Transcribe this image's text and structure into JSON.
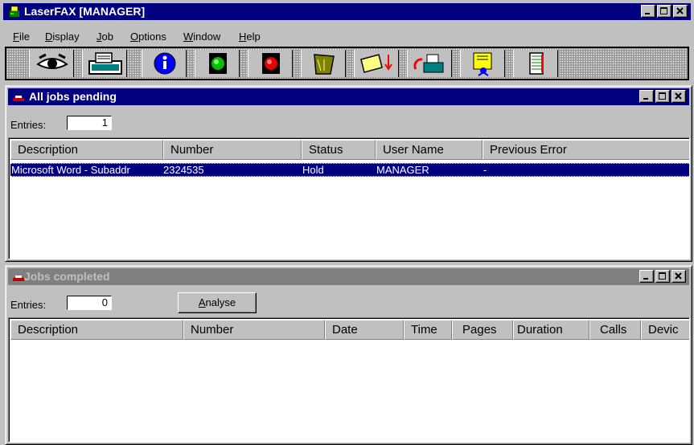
{
  "app": {
    "title": "LaserFAX  [MANAGER]"
  },
  "menu": [
    {
      "label": "File",
      "mnemonic": "F",
      "rest": "ile"
    },
    {
      "label": "Display",
      "mnemonic": "D",
      "rest": "isplay"
    },
    {
      "label": "Job",
      "mnemonic": "J",
      "rest": "ob"
    },
    {
      "label": "Options",
      "mnemonic": "O",
      "rest": "ptions"
    },
    {
      "label": "Window",
      "mnemonic": "W",
      "rest": "indow"
    },
    {
      "label": "Help",
      "mnemonic": "H",
      "rest": "elp"
    }
  ],
  "toolbar": {
    "buttons": [
      {
        "icon": "eye-icon"
      },
      {
        "icon": "fax-machine-icon"
      },
      {
        "icon": "info-icon"
      },
      {
        "icon": "green-light-icon"
      },
      {
        "icon": "red-light-icon"
      },
      {
        "icon": "trash-bin-icon"
      },
      {
        "icon": "folder-arrow-icon"
      },
      {
        "icon": "phone-refresh-icon"
      },
      {
        "icon": "scroll-person-icon"
      },
      {
        "icon": "notebook-icon"
      }
    ]
  },
  "pending": {
    "title": "All jobs pending",
    "entries_label": "Entries:",
    "entries_value": "1",
    "columns": [
      "Description",
      "Number",
      "Status",
      "User Name",
      "Previous Error"
    ],
    "rows": [
      {
        "description": "Microsoft Word - Subaddr",
        "number": "2324535",
        "status": "Hold",
        "user": "MANAGER",
        "error": "-"
      }
    ]
  },
  "completed": {
    "title": "Jobs completed",
    "entries_label": "Entries:",
    "entries_value": "0",
    "analyse": {
      "label": "Analyse",
      "mnemonic": "A",
      "rest": "nalyse"
    },
    "columns": [
      "Description",
      "Number",
      "Date",
      "Time",
      "Pages",
      "Duration",
      "Calls",
      "Devic"
    ]
  },
  "colors": {
    "active_title": "#000080",
    "inactive_title": "#808080",
    "face": "#c0c0c0"
  }
}
